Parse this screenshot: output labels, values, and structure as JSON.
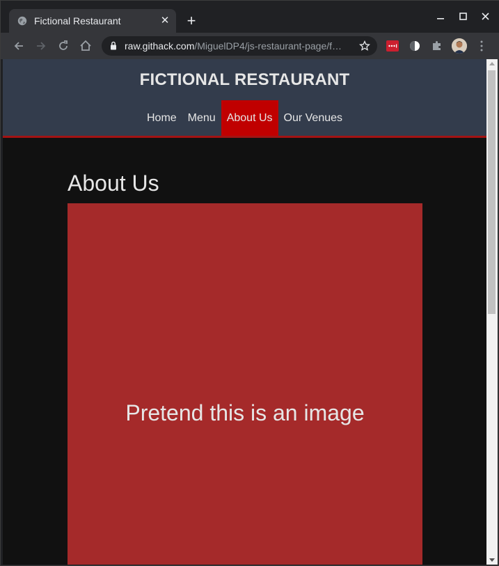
{
  "browser": {
    "tab_title": "Fictional Restaurant",
    "url_host": "raw.githack.com",
    "url_path": "/MiguelDP4/js-restaurant-page/f…",
    "icons": [
      "globe-icon",
      "close-icon",
      "plus-icon",
      "minimize-icon",
      "maximize-icon",
      "close-window-icon",
      "back-icon",
      "forward-icon",
      "reload-icon",
      "home-icon",
      "lock-icon",
      "star-icon",
      "lastpass-icon",
      "dark-mode-icon",
      "puzzle-icon",
      "avatar",
      "kebab-menu-icon"
    ]
  },
  "site": {
    "title": "FICTIONAL RESTAURANT",
    "nav": [
      "Home",
      "Menu",
      "About Us",
      "Our Venues"
    ],
    "active_nav": "About Us",
    "page_heading": "About Us",
    "image_placeholder_text": "Pretend this is an image",
    "colors": {
      "header_bg": "#333c4c",
      "accent_red": "#c00000",
      "placeholder_bg": "#a52a2a",
      "page_bg": "#111111"
    }
  }
}
